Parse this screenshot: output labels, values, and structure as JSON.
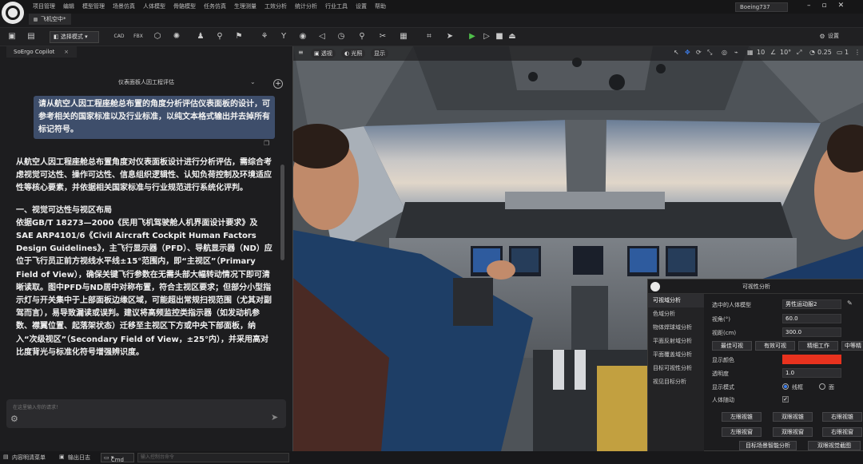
{
  "window": {
    "menu": [
      "项目管理",
      "编辑",
      "模型管理",
      "场景仿真",
      "人体模型",
      "骨骼模型",
      "任务仿真",
      "生理测量",
      "工效分析",
      "统计分析",
      "行业工具",
      "设置",
      "帮助"
    ],
    "project_name": "Boeing737",
    "file_tab": "飞机空中*"
  },
  "toolbar": {
    "mode_label": "选择模式",
    "settings_label": "设置"
  },
  "left_panel": {
    "tab_label": "SoErgo Copilot",
    "chat_title": "仪表面板人因工程评估",
    "user_message": "请从航空人因工程座舱总布置的角度分析评估仪表面板的设计，可参考相关的国家标准以及行业标准，以纯文本格式输出并去掉所有标记符号。",
    "answer_paragraphs": [
      "从航空人因工程座舱总布置角度对仪表面板设计进行分析评估，需综合考虑视觉可达性、操作可达性、信息组织逻辑性、认知负荷控制及环境适应性等核心要素，并依据相关国家标准与行业规范进行系统化评判。",
      "一、视觉可达性与视区布局\n依据GB/T 18273—2000《民用飞机驾驶舱人机界面设计要求》及SAE ARP4101/6《Civil Aircraft Cockpit Human Factors Design Guidelines》，主飞行显示器（PFD）、导航显示器（ND）应位于飞行员正前方视线水平线±15°范围内，即“主视区”（Primary Field of View），确保关键飞行参数在无需头部大幅转动情况下即可清晰读取。图中PFD与ND居中对称布置，符合主视区要求；但部分小型指示灯与开关集中于上部面板边缘区域，可能超出常规扫视范围（尤其对副驾而言），易导致漏读或误判。建议将高频监控类指示器（如发动机参数、襟翼位置、起落架状态）迁移至主视区下方或中央下部面板，纳入“次级视区”（Secondary Field of View，±25°内），并采用高对比度背光与标准化符号增强辨识度。"
    ],
    "input_placeholder": "在这里输入你的请求！"
  },
  "viewport": {
    "mode_label": "透视",
    "light_label": "光照",
    "show_label": "显示",
    "grid_value": "10",
    "angle_value": "10°",
    "speed_value": "0.25",
    "camera_value": "1"
  },
  "vis_panel": {
    "title": "可视性分析",
    "menu": [
      "可视域分析",
      "色域分析",
      "物体焊球域分析",
      "平面反射域分析",
      "平面覆盖域分析",
      "目标可视性分析",
      "视见目标分析"
    ],
    "selected_human_label": "选中的人体模型",
    "selected_human_value": "男性运动服2",
    "view_angle_label": "视角(°)",
    "view_angle_value": "60.0",
    "view_dist_label": "视距(cm)",
    "view_dist_value": "300.0",
    "zone_buttons": [
      "最佳可视",
      "有效可视",
      "精细工作",
      "中等精"
    ],
    "color_label": "显示颜色",
    "color_value": "#e8321e",
    "alpha_label": "透明度",
    "alpha_value": "1.0",
    "mode_label": "显示模式",
    "mode_opt1": "线框",
    "mode_opt2": "面",
    "follow_label": "人体随动",
    "view_buttons": [
      "左眼视锥",
      "双眼视锥",
      "右眼视锥",
      "左眼视窗",
      "双眼视窗",
      "右眼视窗"
    ],
    "bottom_buttons": [
      "目标场景智能分析",
      "双眼视觉截图"
    ]
  },
  "statusbar": {
    "item1": "内容明清菜单",
    "item2": "输出日志",
    "cmd_label": "Cmd",
    "cmd_placeholder": "输入控制台命令"
  }
}
